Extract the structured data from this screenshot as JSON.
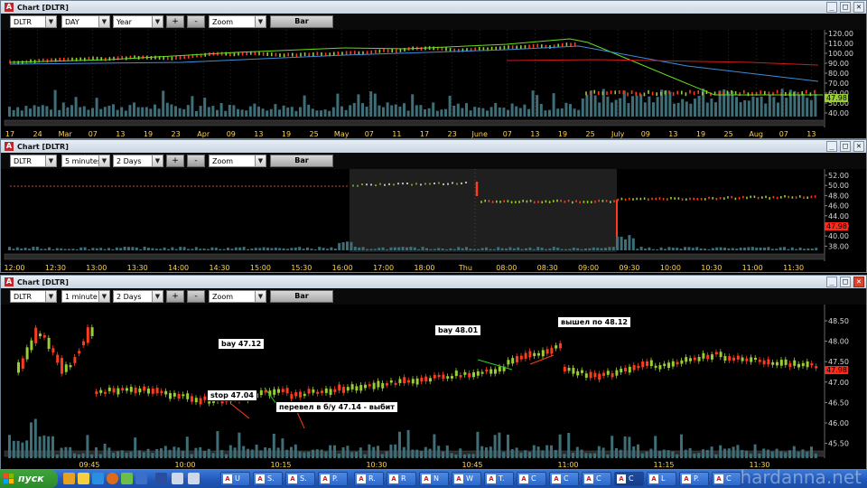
{
  "panels": [
    {
      "title": "Chart [DLTR]",
      "symbol": "DLTR",
      "period": "DAY",
      "range": "Year",
      "zoom": "Zoom",
      "plus": "+",
      "minus": "-",
      "bar": "Bar",
      "last_price": "47.98",
      "y_ticks": [
        "120.00",
        "110.00",
        "100.00",
        "90.00",
        "80.00",
        "70.00",
        "60.00",
        "50.00",
        "40.00"
      ],
      "x_ticks": [
        "17",
        "24",
        "Mar",
        "07",
        "13",
        "19",
        "23",
        "Apr",
        "09",
        "13",
        "19",
        "25",
        "May",
        "07",
        "11",
        "17",
        "23",
        "June",
        "07",
        "13",
        "19",
        "25",
        "July",
        "09",
        "13",
        "19",
        "25",
        "Aug",
        "07",
        "13"
      ]
    },
    {
      "title": "Chart [DLTR]",
      "symbol": "DLTR",
      "period": "5 minutes",
      "range": "2 Days",
      "zoom": "Zoom",
      "plus": "+",
      "minus": "-",
      "bar": "Bar",
      "last_price": "47.98",
      "y_ticks": [
        "52.00",
        "50.00",
        "48.00",
        "46.00",
        "44.00",
        "42.00",
        "40.00",
        "38.00"
      ],
      "x_ticks": [
        "12:00",
        "12:30",
        "13:00",
        "13:30",
        "14:00",
        "14:30",
        "15:00",
        "15:30",
        "16:00",
        "17:00",
        "18:00",
        "Thu",
        "08:00",
        "08:30",
        "09:00",
        "09:30",
        "10:00",
        "10:30",
        "11:00",
        "11:30"
      ]
    },
    {
      "title": "Chart [DLTR]",
      "symbol": "DLTR",
      "period": "1 minute",
      "range": "2 Days",
      "zoom": "Zoom",
      "plus": "+",
      "minus": "-",
      "bar": "Bar",
      "last_price": "47.98",
      "y_ticks": [
        "48.50",
        "48.00",
        "47.50",
        "47.00",
        "46.50",
        "46.00",
        "45.50"
      ],
      "x_ticks": [
        "09:45",
        "10:00",
        "10:15",
        "10:30",
        "10:45",
        "11:00",
        "11:15",
        "11:30"
      ]
    }
  ],
  "annotations": {
    "buy1": "bay 47.12",
    "stop": "stop 47.04",
    "moved": "перевел в б/у 47.14 - выбит",
    "buy2": "bay 48.01",
    "exit": "вышел по 48.12"
  },
  "window_buttons": {
    "min": "_",
    "max": "□",
    "close": "✕"
  },
  "taskbar": {
    "start": "пуск",
    "tasks": [
      "U",
      "S.",
      "S.",
      "P.",
      "R.",
      "R",
      "N",
      "W",
      "T.",
      "C",
      "C",
      "C",
      "C",
      "L",
      "P.",
      "C"
    ]
  },
  "watermark": "hardanna.net",
  "colors": {
    "up": "#9acd32",
    "down": "#ff3b1f",
    "volume": "#3e6f78",
    "sma_fast": "#66dd22",
    "sma_slow": "#3a8fd9",
    "sma_red": "#d11a1a",
    "price_tag": "#ff2a1a"
  }
}
